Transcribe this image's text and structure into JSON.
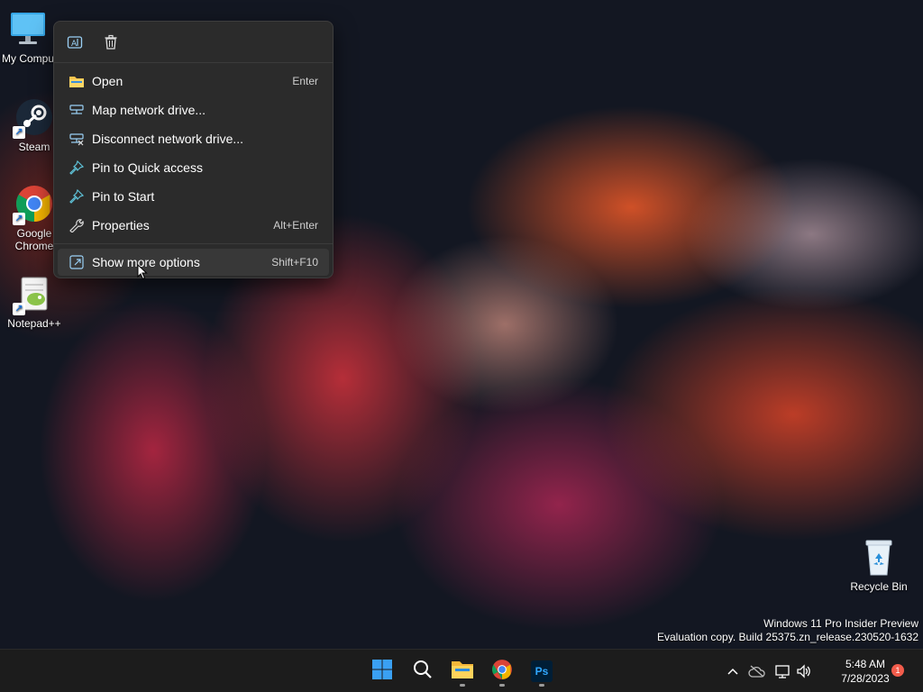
{
  "desktop": {
    "icons": [
      {
        "label": "My Computer",
        "icon": "monitor-icon"
      },
      {
        "label": "Steam",
        "icon": "steam-icon"
      },
      {
        "label": "Google Chrome",
        "icon": "chrome-icon"
      },
      {
        "label": "Notepad++",
        "icon": "notepad-plus-plus-icon"
      },
      {
        "label": "Recycle Bin",
        "icon": "recycle-bin-icon"
      }
    ],
    "watermark": {
      "line1": "Windows 11 Pro Insider Preview",
      "line2": "Evaluation copy. Build 25375.zn_release.230520-1632"
    }
  },
  "context_menu": {
    "toolbar": [
      {
        "name": "rename",
        "icon": "rename-icon"
      },
      {
        "name": "delete",
        "icon": "trash-icon"
      }
    ],
    "items": [
      {
        "label": "Open",
        "shortcut": "Enter",
        "icon": "folder-icon"
      },
      {
        "label": "Map network drive...",
        "shortcut": "",
        "icon": "map-network-drive-icon"
      },
      {
        "label": "Disconnect network drive...",
        "shortcut": "",
        "icon": "disconnect-network-drive-icon"
      },
      {
        "label": "Pin to Quick access",
        "shortcut": "",
        "icon": "pin-icon"
      },
      {
        "label": "Pin to Start",
        "shortcut": "",
        "icon": "pin-icon"
      },
      {
        "label": "Properties",
        "shortcut": "Alt+Enter",
        "icon": "wrench-icon"
      },
      {
        "label": "Show more options",
        "shortcut": "Shift+F10",
        "icon": "more-options-icon"
      }
    ]
  },
  "taskbar": {
    "apps": [
      "start-icon",
      "search-icon",
      "file-explorer-icon",
      "chrome-icon",
      "photoshop-icon"
    ],
    "photoshop_label": "Ps",
    "tray_icons": [
      "chevron-up-icon",
      "onedrive-icon",
      "network-icon",
      "volume-icon"
    ],
    "time": "5:48 AM",
    "date": "7/28/2023",
    "notification_count": "1"
  },
  "colors": {
    "menu_bg": "#2b2b2b",
    "taskbar_bg": "#1c1c1c",
    "accent_blue": "#0078d4",
    "notification_badge": "#f25c4b"
  }
}
